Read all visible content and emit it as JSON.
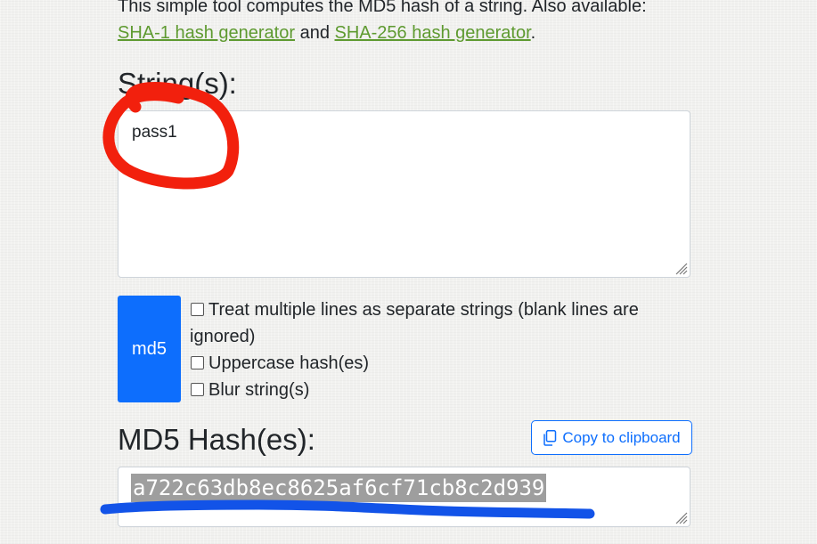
{
  "intro": {
    "text": "This simple tool computes the MD5 hash of a string. Also available:",
    "link1": "SHA-1 hash generator",
    "joiner": "and",
    "link2": "SHA-256 hash generator",
    "end": "."
  },
  "input": {
    "heading": "String(s):",
    "value": "pass1"
  },
  "controls": {
    "hash_button": "md5",
    "options": [
      {
        "label": "Treat multiple lines as separate strings (blank lines are ignored)",
        "checked": false
      },
      {
        "label": "Uppercase hash(es)",
        "checked": false
      },
      {
        "label": "Blur string(s)",
        "checked": false
      }
    ]
  },
  "output": {
    "heading": "MD5 Hash(es):",
    "copy_label": "Copy to clipboard",
    "value": "a722c63db8ec8625af6cf71cb8c2d939",
    "selected": true
  },
  "colors": {
    "link": "#5e9a30",
    "primary": "#0d6efd",
    "annotation_circle": "#f2200d",
    "annotation_underline": "#1253e8",
    "selection": "#9e9e9e"
  },
  "icons": [
    "copy-icon",
    "resize-grip-icon"
  ]
}
